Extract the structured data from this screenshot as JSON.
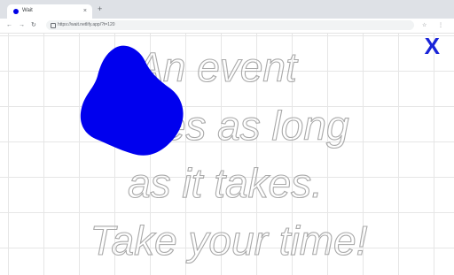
{
  "browser": {
    "tab": {
      "title": "Wait",
      "close_glyph": "×"
    },
    "new_tab_glyph": "+",
    "nav": {
      "back_glyph": "←",
      "forward_glyph": "→",
      "reload_glyph": "↻"
    },
    "address_bar": {
      "url": "https://wait.netlify.app/?t=120"
    },
    "toolbar_icons": {
      "bookmark_glyph": "☆",
      "menu_glyph": "⋮"
    }
  },
  "page": {
    "close_label": "X",
    "quote_lines": [
      "An event",
      "takes as long",
      "as it takes.",
      "Take your time!"
    ],
    "accent_color": "#0000ee",
    "outline_color": "#a9a9a9",
    "grid_color": "#e6e6e6"
  }
}
